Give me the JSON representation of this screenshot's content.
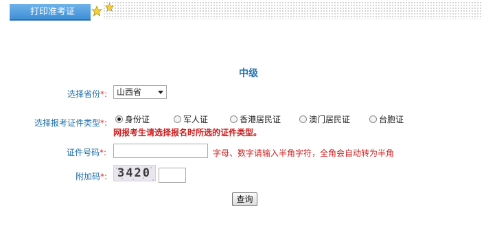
{
  "header": {
    "tab_label": "打印准考证"
  },
  "form": {
    "title": "中级",
    "province": {
      "label": "选择省份",
      "required_mark": "*:",
      "selected": "山西省"
    },
    "id_type": {
      "label": "选择报考证件类型",
      "required_mark": "*:",
      "options": [
        "身份证",
        "军人证",
        "香港居民证",
        "澳门居民证",
        "台胞证"
      ],
      "selected_index": 0,
      "warning": "网报考生请选择报名时所选的证件类型。"
    },
    "id_number": {
      "label": "证件号码",
      "required_mark": "*:",
      "value": "",
      "hint": "字母、数字请输入半角字符，全角会自动转为半角"
    },
    "captcha": {
      "label": "附加码",
      "required_mark": "*:",
      "image_text": "3420",
      "value": ""
    },
    "submit_label": "查询"
  },
  "icons": [
    "star-icon",
    "star-icon"
  ],
  "colors": {
    "accent": "#1d74b8",
    "tab_bg": "#4b9ade",
    "error": "#cc1f1f"
  }
}
